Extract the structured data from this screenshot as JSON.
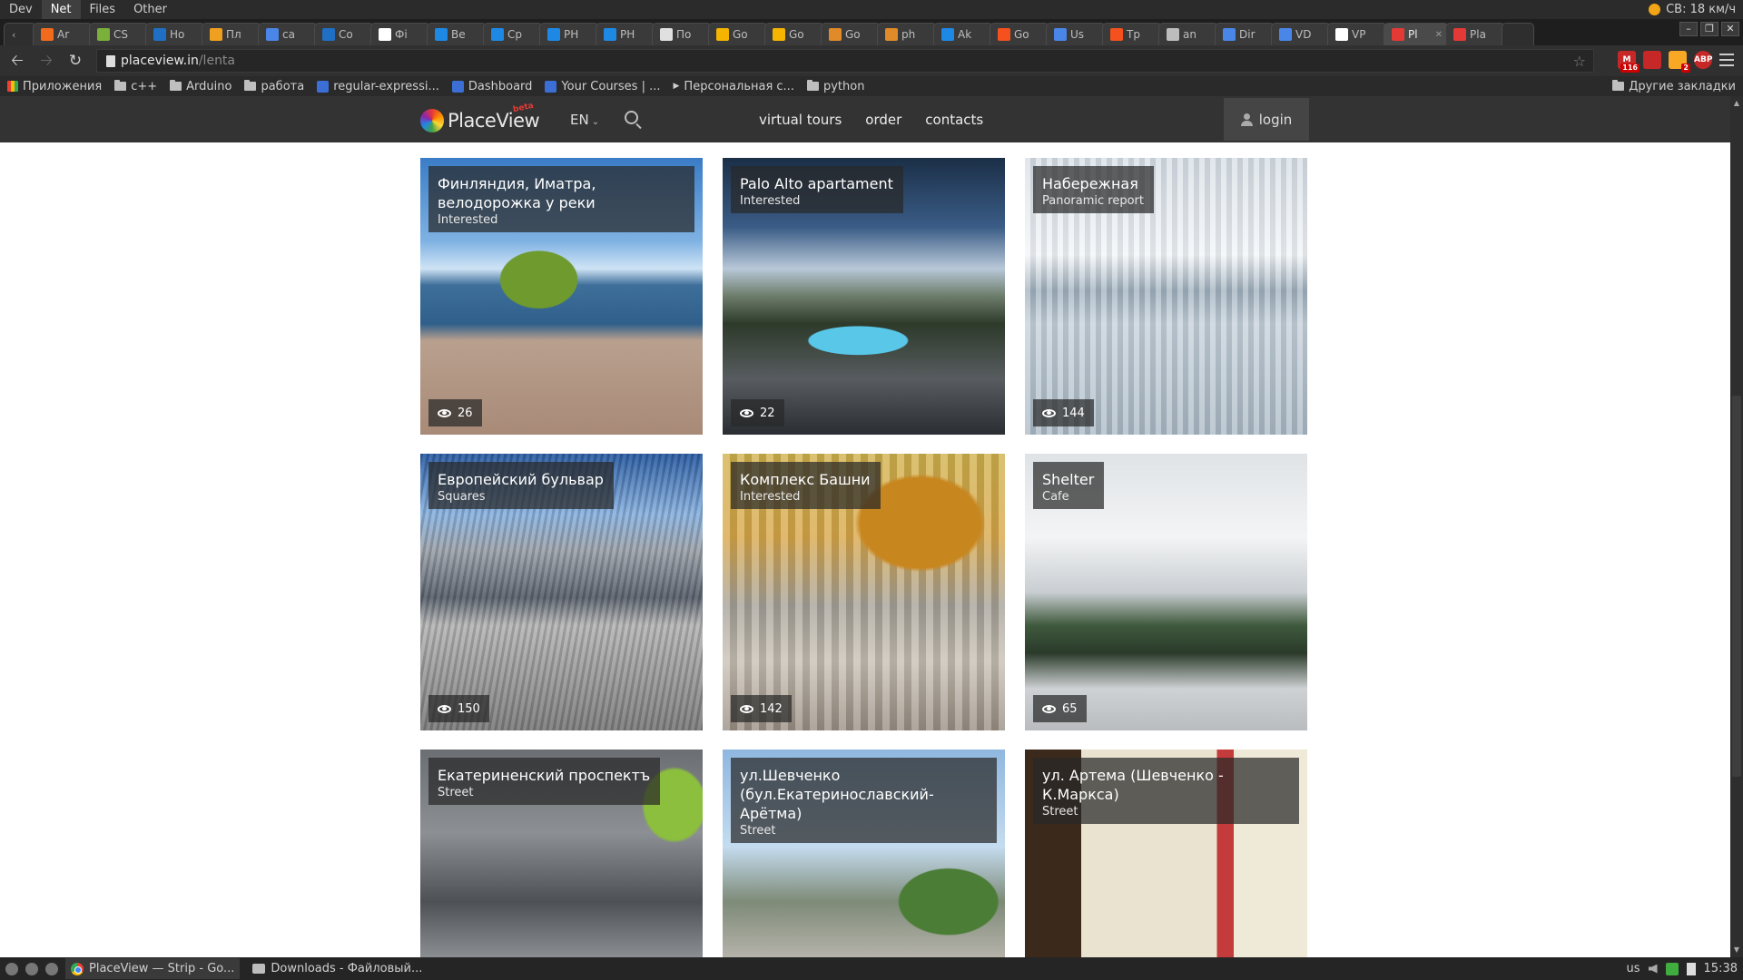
{
  "system_bar": {
    "menus": [
      "Dev",
      "Net",
      "Files",
      "Other"
    ],
    "active_menu": "Net",
    "weather": "СВ: 18 км/ч"
  },
  "tabs": [
    {
      "label": "Ar",
      "color": "#f26b1d"
    },
    {
      "label": "CS",
      "color": "#7bb03a"
    },
    {
      "label": "Ho",
      "color": "#1f6fc5"
    },
    {
      "label": "Пл",
      "color": "#f0a020"
    },
    {
      "label": "ca",
      "color": "#4a86e8"
    },
    {
      "label": "Co",
      "color": "#1f6fc5"
    },
    {
      "label": "Фі",
      "color": "#ffffff"
    },
    {
      "label": "Be",
      "color": "#1e88e5"
    },
    {
      "label": "Cp",
      "color": "#1e88e5"
    },
    {
      "label": "PH",
      "color": "#1e88e5"
    },
    {
      "label": "PH",
      "color": "#1e88e5"
    },
    {
      "label": "По",
      "color": "#e0e0e0"
    },
    {
      "label": "Go",
      "color": "#f4b400"
    },
    {
      "label": "Go",
      "color": "#f4b400"
    },
    {
      "label": "Go",
      "color": "#e08a2a"
    },
    {
      "label": "ph",
      "color": "#e08a2a"
    },
    {
      "label": "Ak",
      "color": "#1e88e5"
    },
    {
      "label": "Go",
      "color": "#f4511e"
    },
    {
      "label": "Us",
      "color": "#4a86e8"
    },
    {
      "label": "Tp",
      "color": "#f4511e"
    },
    {
      "label": "an",
      "color": "#bdbdbd"
    },
    {
      "label": "Dir",
      "color": "#4a86e8"
    },
    {
      "label": "VD",
      "color": "#4a86e8"
    },
    {
      "label": "VP",
      "color": "#ffffff"
    },
    {
      "label": "Pl",
      "color": "#e53935",
      "active": true
    },
    {
      "label": "Pla",
      "color": "#e53935"
    }
  ],
  "address_bar": {
    "host": "placeview.in",
    "path": "/lenta"
  },
  "extensions": [
    {
      "name": "gmail",
      "badge": "116",
      "color": "#c62828"
    },
    {
      "name": "bookmark",
      "badge": "",
      "color": "#c62828"
    },
    {
      "name": "notes",
      "badge": "2",
      "color": "#f9a825"
    },
    {
      "name": "adblock",
      "badge": "",
      "color": "#c62828",
      "label": "ABP"
    }
  ],
  "bookmarks": {
    "items": [
      {
        "label": "Приложения",
        "icon": "apps-icon"
      },
      {
        "label": "c++",
        "icon": "folder-icon"
      },
      {
        "label": "Arduino",
        "icon": "folder-icon"
      },
      {
        "label": "работа",
        "icon": "folder-icon"
      },
      {
        "label": "regular-expressi...",
        "icon": "site-icon"
      },
      {
        "label": "Dashboard",
        "icon": "site-icon"
      },
      {
        "label": "Your Courses | ...",
        "icon": "site-icon"
      },
      {
        "label": "Персональная с...",
        "icon": "play-icon"
      },
      {
        "label": "python",
        "icon": "folder-icon"
      }
    ],
    "other": "Другие закладки"
  },
  "site": {
    "logo_text": "PlaceView",
    "logo_badge": "beta",
    "language": "EN",
    "nav": [
      "virtual tours",
      "order",
      "contacts"
    ],
    "login": "login"
  },
  "cards": [
    {
      "title": "Финляндия, Иматра, велодорожка у реки",
      "category": "Interested",
      "views": "26"
    },
    {
      "title": "Palo Alto apartament",
      "category": "Interested",
      "views": "22"
    },
    {
      "title": "Набережная",
      "category": "Panoramic report",
      "views": "144"
    },
    {
      "title": "Европейский бульвар",
      "category": "Squares",
      "views": "150"
    },
    {
      "title": "Комплекс Башни",
      "category": "Interested",
      "views": "142"
    },
    {
      "title": "Shelter",
      "category": "Cafe",
      "views": "65"
    },
    {
      "title": "Екатериненский проспектъ",
      "category": "Street",
      "views": ""
    },
    {
      "title": "ул.Шевченко (бул.Екатеринославский-Арётма)",
      "category": "Street",
      "views": ""
    },
    {
      "title": "ул. Артема (Шевченко - К.Маркса)",
      "category": "Street",
      "views": ""
    }
  ],
  "taskbar": {
    "tasks": [
      "PlaceView — Strip - Go...",
      "Downloads - Файловый..."
    ],
    "layout": "us",
    "time": "15:38"
  }
}
